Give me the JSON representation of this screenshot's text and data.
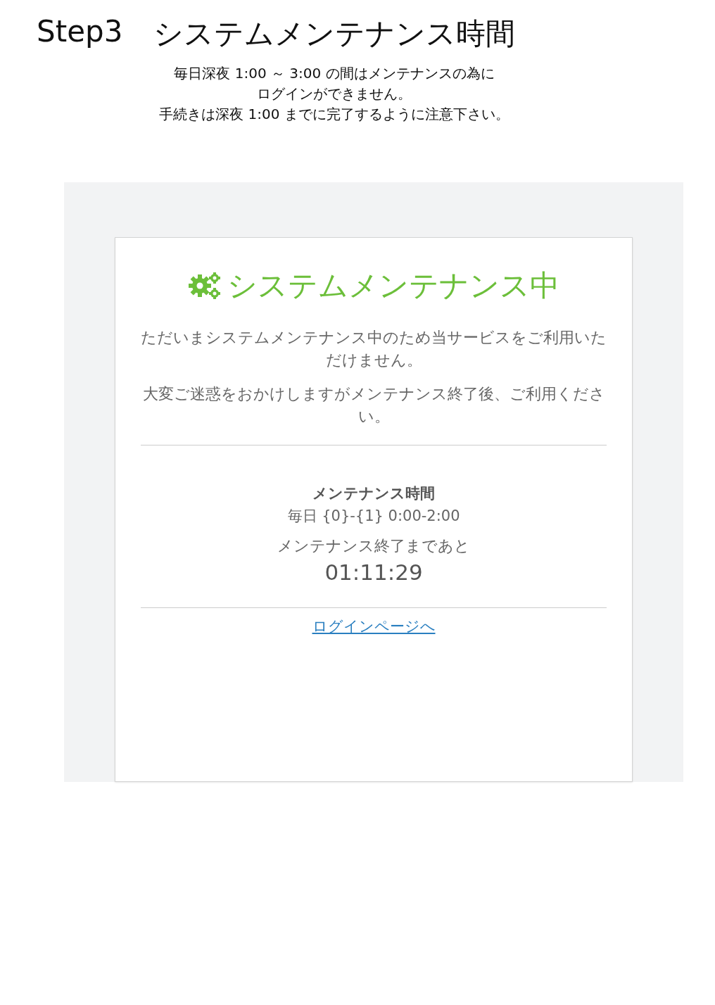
{
  "heading": {
    "step": "Step3",
    "title": "システムメンテナンス時間"
  },
  "intro": [
    "毎日深夜 1:00 ～ 3:00 の間はメンテナンスの為に",
    "ログインができません。",
    "手続きは深夜 1:00 までに完了するように注意下さい。"
  ],
  "card": {
    "title": "システムメンテナンス中",
    "messages": [
      "ただいまシステムメンテナンス中のため当サービスをご利用いただけません。",
      "大変ご迷惑をおかけしますがメンテナンス終了後、ご利用ください。"
    ],
    "schedule_label": "メンテナンス時間",
    "schedule": "毎日 {0}-{1} 0:00-2:00",
    "remaining_label": "メンテナンス終了まであと",
    "remaining": "01:11:29",
    "link": "ログインページへ"
  }
}
